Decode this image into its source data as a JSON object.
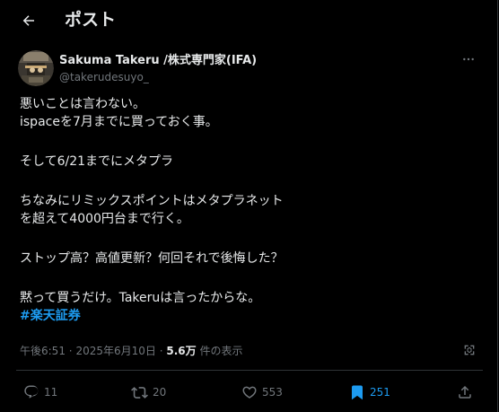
{
  "header": {
    "title": "ポスト",
    "back_icon": "arrow-left-icon"
  },
  "author": {
    "name": "Sakuma Takeru /株式専門家(IFA)",
    "handle": "@takerudesuyo_",
    "avatar_icon": "avatar-photo"
  },
  "tweet": {
    "lines": [
      "悪いことは言わない。",
      "ispaceを7月までに買っておく事。",
      "そして6/21までにメタプラ",
      "ちなみにリミックスポイントはメタプラネット",
      "を超えて4000円台まで行く。",
      "ストップ高？高値更新？何回それで後悔した？",
      "黙って買うだけ。Takeruは言ったからな。"
    ],
    "hashtag": "#楽天証券"
  },
  "meta": {
    "time": "午後6:51",
    "separator": "·",
    "date": "2025年6月10日",
    "separator2": "·",
    "views": "5.6万",
    "views_label": "件の表示"
  },
  "actions": {
    "reply_count": "11",
    "repost_count": "20",
    "like_count": "553",
    "bookmark_count": "251"
  },
  "colors": {
    "background": "#000000",
    "text": "#e7e9ea",
    "muted": "#71767b",
    "accent": "#1d9bf0",
    "divider": "#2f3336"
  }
}
